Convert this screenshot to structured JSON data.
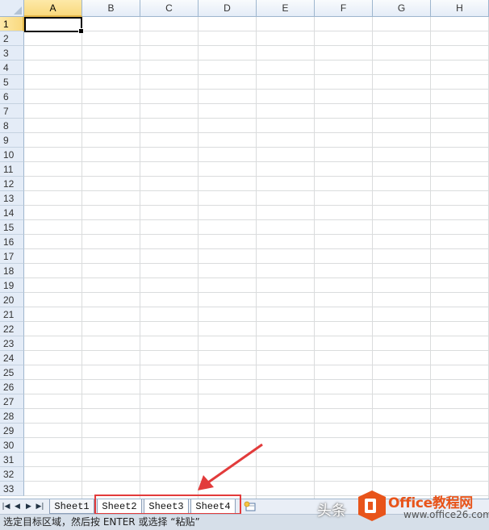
{
  "columns": [
    "A",
    "B",
    "C",
    "D",
    "E",
    "F",
    "G",
    "H"
  ],
  "rows": [
    "1",
    "2",
    "3",
    "4",
    "5",
    "6",
    "7",
    "8",
    "9",
    "10",
    "11",
    "12",
    "13",
    "14",
    "15",
    "16",
    "17",
    "18",
    "19",
    "20",
    "21",
    "22",
    "23",
    "24",
    "25",
    "26",
    "27",
    "28",
    "29",
    "30",
    "31",
    "32",
    "33"
  ],
  "selected_cell": {
    "column": "A",
    "row": "1"
  },
  "nav_buttons": [
    {
      "name": "first-sheet-button",
      "glyph": "|◀"
    },
    {
      "name": "prev-sheet-button",
      "glyph": "◀"
    },
    {
      "name": "next-sheet-button",
      "glyph": "▶"
    },
    {
      "name": "last-sheet-button",
      "glyph": "▶|"
    }
  ],
  "sheet_tabs": [
    "Sheet1",
    "Sheet2",
    "Sheet3",
    "Sheet4"
  ],
  "selected_tabs": [
    "Sheet2",
    "Sheet3",
    "Sheet4"
  ],
  "status": {
    "message": "选定目标区域，然后按 ENTER 或选择 “粘贴”"
  },
  "watermark": {
    "prefix": "头条",
    "brand": "Office教程网",
    "site": "www.office26.com"
  },
  "colors": {
    "header_bg": "#e4ecf7",
    "selected_header": "#f9d97e",
    "highlight_box": "#e23b3b",
    "brand": "#e8541a"
  }
}
